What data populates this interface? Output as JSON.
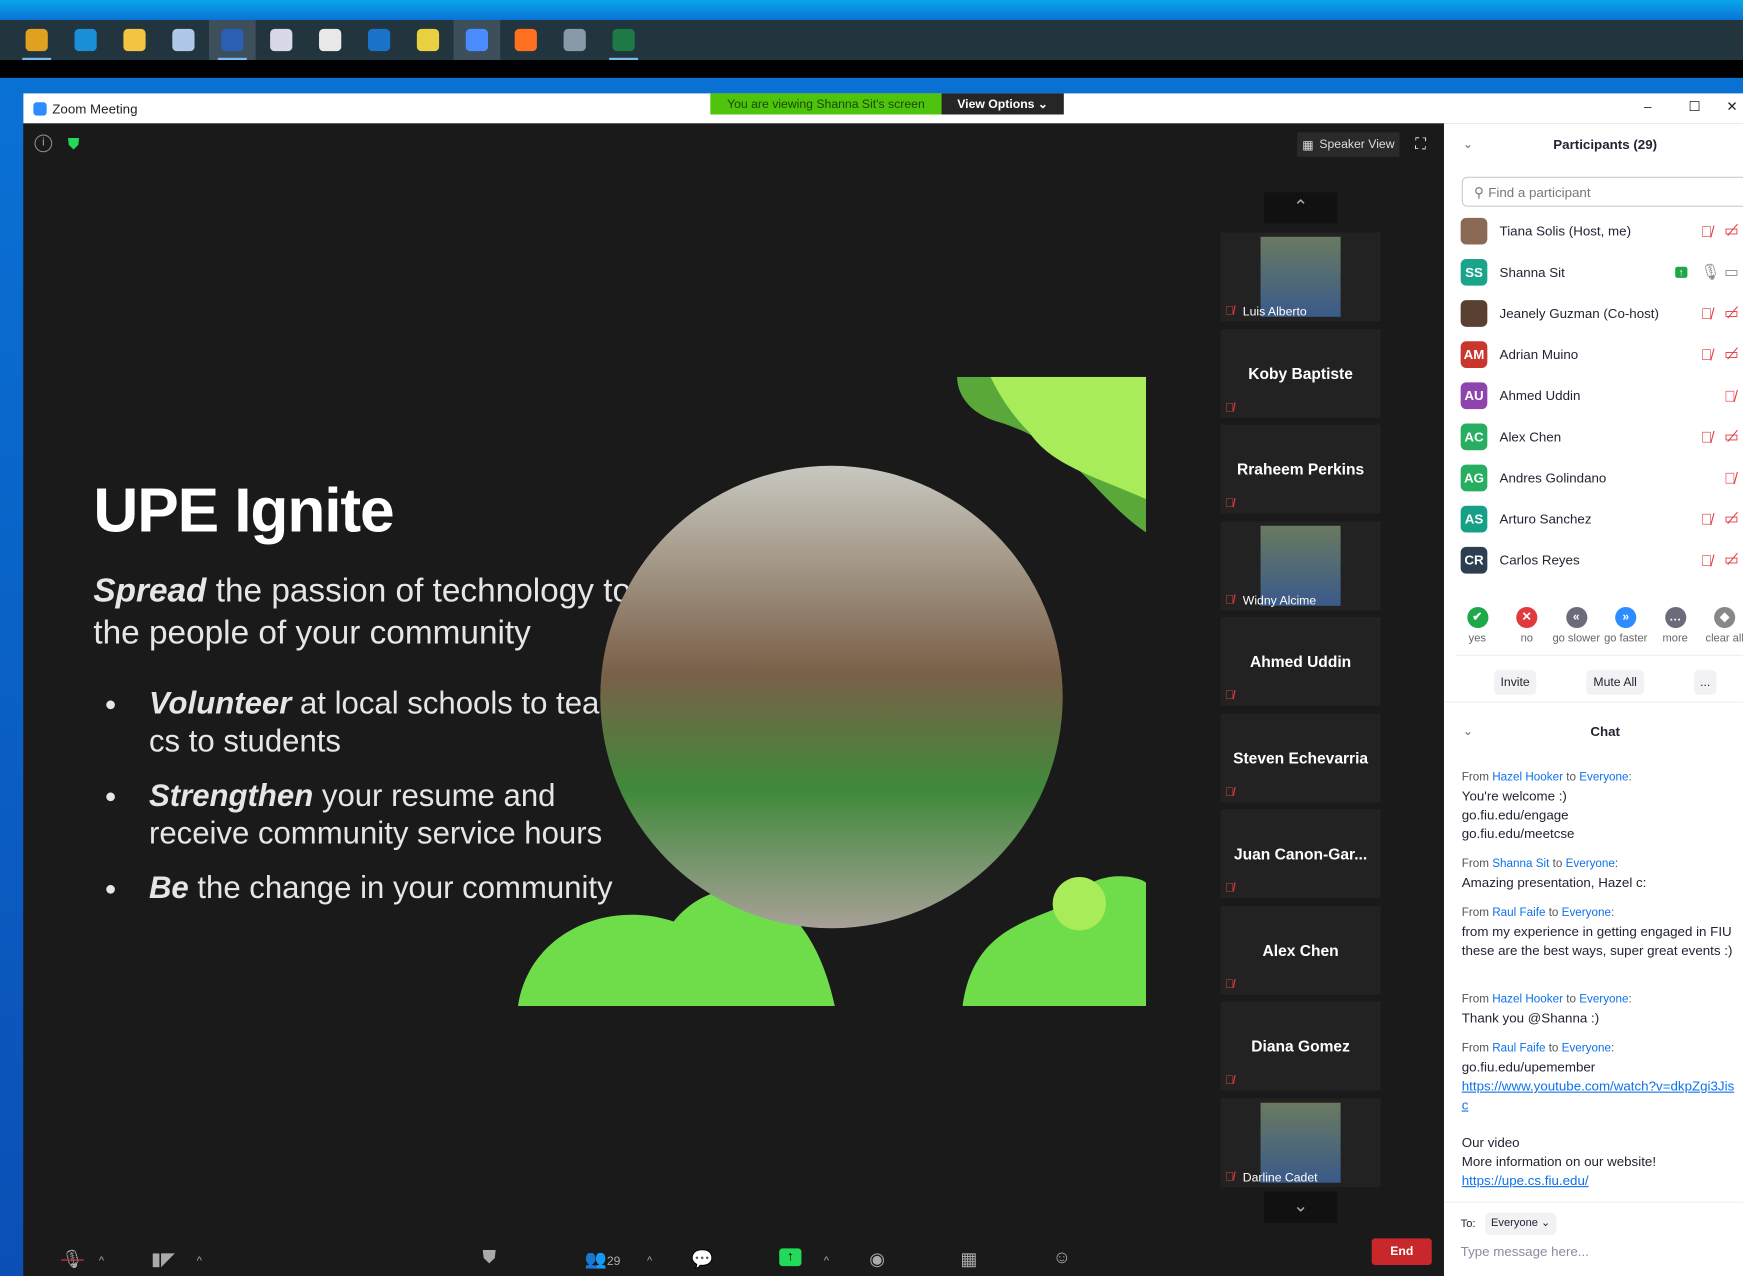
{
  "taskbar": {
    "apps": [
      "chrome",
      "edge",
      "file-explorer",
      "virtualbox",
      "word",
      "paint",
      "snipping",
      "outlook",
      "network",
      "zoom",
      "firefox",
      "calculator",
      "excel"
    ],
    "colors": [
      "#e0a020",
      "#1a8fd8",
      "#f2c441",
      "#b0c8e8",
      "#2b5fb3",
      "#d8d8e8",
      "#e8e8e8",
      "#1a73c8",
      "#e8d040",
      "#4a8cff",
      "#ff7020",
      "#889aa8",
      "#1e7a44"
    ]
  },
  "window": {
    "title": "Zoom Meeting",
    "banner": "You are viewing Shanna Sit's screen",
    "view_options": "View Options ⌄",
    "minimize": "–",
    "maximize": "☐",
    "close": "✕"
  },
  "video": {
    "speaker_view": "Speaker View",
    "slide": {
      "title": "UPE Ignite",
      "sub_bold": "Spread",
      "sub_rest": " the passion of technology to the people of your community",
      "bullets": [
        {
          "bold": "Volunteer",
          "rest": " at local schools to teach cs to students"
        },
        {
          "bold": "Strengthen",
          "rest": " your resume and receive community service hours"
        },
        {
          "bold": "Be",
          "rest": " the change in your community"
        }
      ]
    },
    "tiles": [
      {
        "name": "Luis Alberto",
        "photo": true
      },
      {
        "name": "Koby Baptiste"
      },
      {
        "name": "Rraheem Perkins"
      },
      {
        "name": "Widny Alcime",
        "photo": true
      },
      {
        "name": "Ahmed Uddin"
      },
      {
        "name": "Steven Echevarria"
      },
      {
        "name": "Juan  Canon-Gar..."
      },
      {
        "name": "Alex Chen"
      },
      {
        "name": "Diana Gomez"
      },
      {
        "name": "Darline Cadet",
        "photo": true
      }
    ]
  },
  "toolbar": {
    "participants_count": "29",
    "end": "End"
  },
  "participants": {
    "title": "Participants (29)",
    "search_placeholder": "Find a participant",
    "list": [
      {
        "name": "Tiana Solis (Host, me)",
        "initials": "",
        "color": "#8a6a55",
        "video": true
      },
      {
        "name": "Shanna Sit",
        "initials": "SS",
        "color": "#1aa58a",
        "sharing": true
      },
      {
        "name": "Jeanely Guzman (Co-host)",
        "initials": "",
        "color": "#5a4030",
        "video": true
      },
      {
        "name": "Adrian Muino",
        "initials": "AM",
        "color": "#c8362c",
        "video": true
      },
      {
        "name": "Ahmed Uddin",
        "initials": "AU",
        "color": "#8e44ad",
        "video": false
      },
      {
        "name": "Alex Chen",
        "initials": "AC",
        "color": "#27ae60",
        "video": true
      },
      {
        "name": "Andres Golindano",
        "initials": "AG",
        "color": "#27ae60",
        "video": false
      },
      {
        "name": "Arturo Sanchez",
        "initials": "AS",
        "color": "#16a085",
        "video": true
      },
      {
        "name": "Carlos Reyes",
        "initials": "CR",
        "color": "#2c3e50",
        "video": true
      }
    ],
    "reactions": [
      {
        "label": "yes",
        "color": "#1ea84a",
        "glyph": "✔"
      },
      {
        "label": "no",
        "color": "#e0393e",
        "glyph": "✕"
      },
      {
        "label": "go slower",
        "color": "#6b6b7a",
        "glyph": "«"
      },
      {
        "label": "go faster",
        "color": "#2d8cff",
        "glyph": "»"
      },
      {
        "label": "more",
        "color": "#6b6b7a",
        "glyph": "…"
      },
      {
        "label": "clear all",
        "color": "#888",
        "glyph": "◆"
      }
    ],
    "invite": "Invite",
    "mute_all": "Mute All",
    "more": "..."
  },
  "chat": {
    "title": "Chat",
    "to_label": "To:",
    "to_value": "Everyone ⌄",
    "placeholder": "Type message here...",
    "messages": [
      {
        "from": "Hazel Hooker",
        "to": "Everyone",
        "lines": [
          "You're welcome :)",
          "go.fiu.edu/engage",
          "go.fiu.edu/meetcse"
        ]
      },
      {
        "from": "Shanna Sit",
        "to": "Everyone",
        "lines": [
          "Amazing presentation, Hazel c:"
        ]
      },
      {
        "from": "Raul Faife",
        "to": "Everyone",
        "lines": [
          "from my experience in getting engaged in FIU these are the best ways, super great events :)"
        ]
      },
      {
        "from": "Hazel Hooker",
        "to": "Everyone",
        "lines": [
          "Thank you @Shanna :)"
        ]
      },
      {
        "from": "Raul Faife",
        "to": "Everyone",
        "lines": [
          "go.fiu.edu/upemember"
        ],
        "link1": "https://www.youtube.com/watch?v=dkpZgi3Jisc",
        "after": [
          "",
          "Our video",
          "More information on our website!"
        ],
        "link2": "https://upe.cs.fiu.edu/"
      }
    ]
  }
}
